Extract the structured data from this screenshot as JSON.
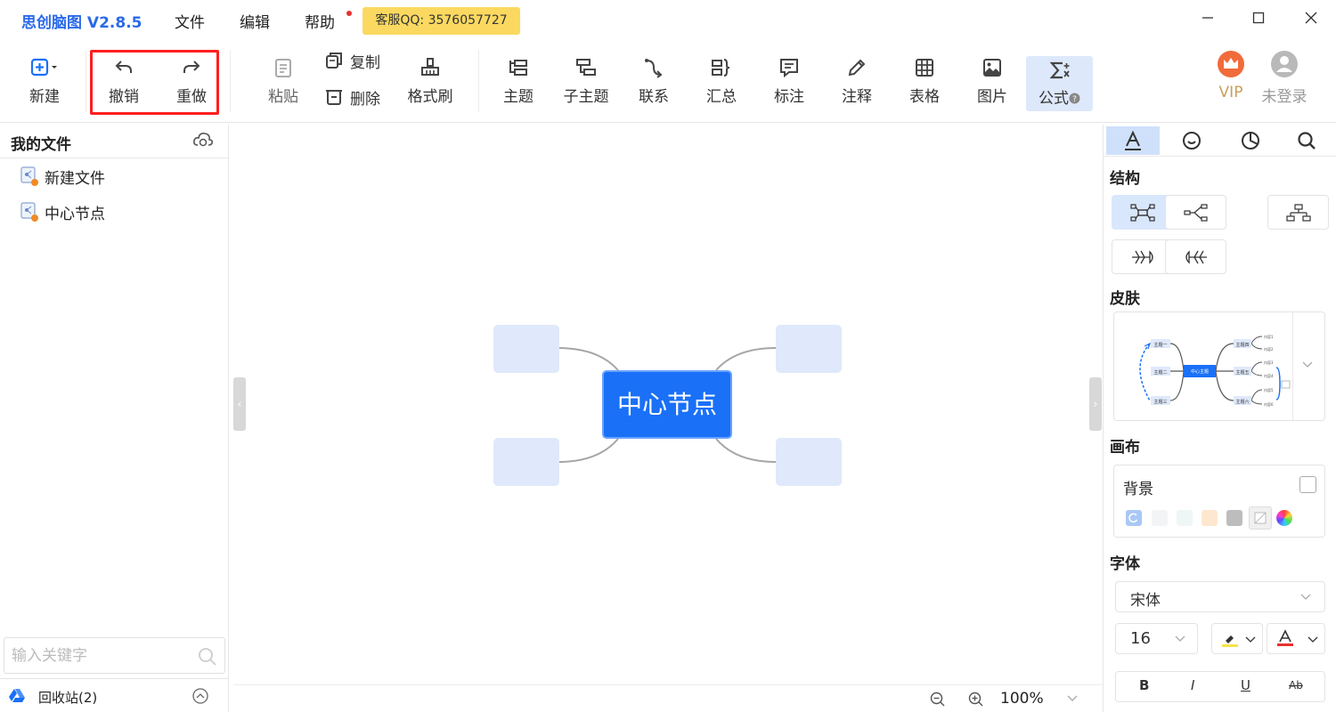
{
  "app": {
    "title": "思创脑图 V2.8.5"
  },
  "menu": {
    "file": "文件",
    "edit": "编辑",
    "help": "帮助"
  },
  "support": {
    "qq": "客服QQ: 3576057727"
  },
  "toolbar": {
    "new": "新建",
    "undo": "撤销",
    "redo": "重做",
    "paste": "粘贴",
    "copy": "复制",
    "delete": "删除",
    "format_painter": "格式刷",
    "topic": "主题",
    "subtopic": "子主题",
    "relation": "联系",
    "summary": "汇总",
    "label": "标注",
    "note": "注释",
    "table": "表格",
    "image": "图片",
    "formula": "公式",
    "vip": "VIP",
    "login": "未登录"
  },
  "sidebar": {
    "title": "我的文件",
    "files": [
      {
        "name": "新建文件"
      },
      {
        "name": "中心节点"
      }
    ],
    "search_placeholder": "输入关键字",
    "recycle": "回收站(2)"
  },
  "canvas": {
    "center_node": "中心节点",
    "zoom": "100%"
  },
  "right_panel": {
    "structure": "结构",
    "skin": "皮肤",
    "skin_preview": {
      "center": "中心主题",
      "left": [
        "主题一",
        "主题二",
        "主题三"
      ],
      "right": [
        "主题四",
        "主题五",
        "主题六"
      ],
      "leaves": [
        "内容1",
        "内容2",
        "内容3",
        "内容4",
        "内容5",
        "内容6"
      ]
    },
    "canvas_section": "画布",
    "background": "背景",
    "font_section": "字体",
    "font_family": "宋体",
    "font_size": "16",
    "format": {
      "bold": "B",
      "italic": "I",
      "underline": "U",
      "strike": "Ab"
    }
  },
  "colors": {
    "accent": "#1a70f7",
    "title": "#2a6ae8",
    "highlight": "#ff1f1f",
    "qq_badge": "#fbd960",
    "node_bg": "#dfe9fb",
    "swatches": [
      "#a9c8f5",
      "#f2f4f6",
      "#eef6f6",
      "#fde8cf",
      "#bdbdbd",
      "#f0f0f0"
    ]
  }
}
